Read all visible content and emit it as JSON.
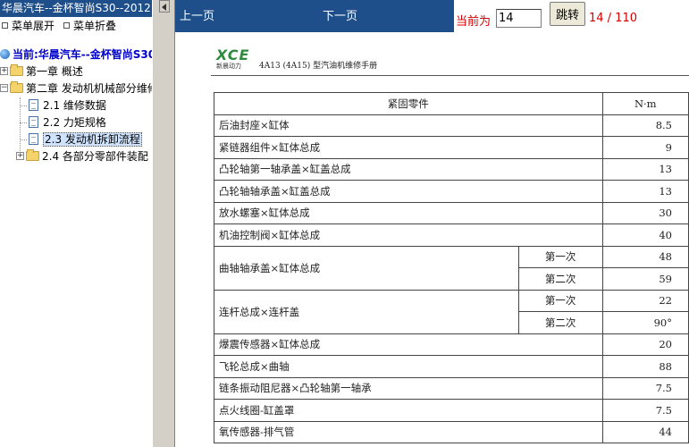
{
  "left_panel": {
    "title": "华晨汽车--金杯智尚S30--2012",
    "expand_all": "菜单展开",
    "collapse_all": "菜单折叠",
    "current_label": "当前:华晨汽车--金杯智尚S30--2012",
    "tree": [
      {
        "label": "第一章 概述",
        "expander": "+"
      },
      {
        "label": "第二章 发动机机械部分维修",
        "expander": "−"
      },
      {
        "label": "2.1 维修数据"
      },
      {
        "label": "2.2 力矩规格"
      },
      {
        "label": "2.3 发动机拆卸流程",
        "selected": true
      },
      {
        "label": "2.4 各部分零部件装配",
        "expander": "+"
      }
    ]
  },
  "nav": {
    "prev": "上一页",
    "next": "下一页",
    "current_label": "当前为",
    "page_value": "14",
    "jump": "跳转",
    "page_count": "14 / 110"
  },
  "doc": {
    "logo_text": "XCE",
    "logo_sub": "新晨动力",
    "header": "4A13 (4A15)  型汽油机维修手册",
    "table_head": {
      "part": "紧固零件",
      "unit": "N·m"
    },
    "rows": [
      {
        "part": "后油封座×缸体",
        "value": "8.5"
      },
      {
        "part": "紧链器组件×缸体总成",
        "value": "9"
      },
      {
        "part": "凸轮轴第一轴承盖×缸盖总成",
        "value": "13"
      },
      {
        "part": "凸轮轴轴承盖×缸盖总成",
        "value": "13"
      },
      {
        "part": "放水螺塞×缸体总成",
        "value": "30"
      },
      {
        "part": "机油控制阀×缸体总成",
        "value": "40"
      },
      {
        "part": "曲轴轴承盖×缸体总成",
        "step1": "第一次",
        "value1": "48",
        "step2": "第二次",
        "value2": "59"
      },
      {
        "part": "连杆总成×连杆盖",
        "step1": "第一次",
        "value1": "22",
        "step2": "第二次",
        "value2": "90°"
      },
      {
        "part": "爆震传感器×缸体总成",
        "value": "20"
      },
      {
        "part": "飞轮总成×曲轴",
        "value": "88"
      },
      {
        "part": "链条振动阻尼器×凸轮轴第一轴承",
        "value": "7.5"
      },
      {
        "part": "点火线圈-缸盖罩",
        "value": "7.5"
      },
      {
        "part": "氧传感器-排气管",
        "value": "44"
      }
    ]
  }
}
